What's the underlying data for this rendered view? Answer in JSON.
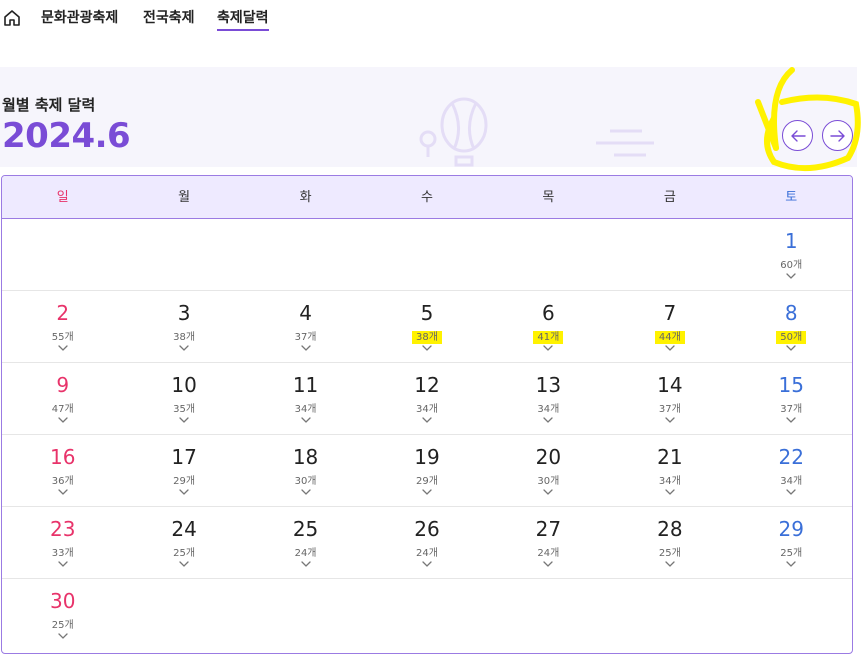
{
  "nav": {
    "items": [
      {
        "label": "문화관광축제"
      },
      {
        "label": "전국축제"
      },
      {
        "label": "축제달력",
        "active": true
      }
    ]
  },
  "header": {
    "subtitle": "월별 축제 달력",
    "month": "2024.6"
  },
  "colors": {
    "accent": "#7a4cd6",
    "sunday": "#e8336a",
    "saturday": "#3a6fd8",
    "highlight": "#fff200"
  },
  "weekdays": [
    "일",
    "월",
    "화",
    "수",
    "목",
    "금",
    "토"
  ],
  "weeks": [
    [
      null,
      null,
      null,
      null,
      null,
      null,
      {
        "day": "1",
        "count": "60개"
      }
    ],
    [
      {
        "day": "2",
        "count": "55개"
      },
      {
        "day": "3",
        "count": "38개"
      },
      {
        "day": "4",
        "count": "37개"
      },
      {
        "day": "5",
        "count": "38개",
        "highlighted": true
      },
      {
        "day": "6",
        "count": "41개",
        "highlighted": true
      },
      {
        "day": "7",
        "count": "44개",
        "highlighted": true
      },
      {
        "day": "8",
        "count": "50개",
        "highlighted": true
      }
    ],
    [
      {
        "day": "9",
        "count": "47개"
      },
      {
        "day": "10",
        "count": "35개"
      },
      {
        "day": "11",
        "count": "34개"
      },
      {
        "day": "12",
        "count": "34개"
      },
      {
        "day": "13",
        "count": "34개"
      },
      {
        "day": "14",
        "count": "37개"
      },
      {
        "day": "15",
        "count": "37개"
      }
    ],
    [
      {
        "day": "16",
        "count": "36개"
      },
      {
        "day": "17",
        "count": "29개"
      },
      {
        "day": "18",
        "count": "30개"
      },
      {
        "day": "19",
        "count": "29개"
      },
      {
        "day": "20",
        "count": "30개"
      },
      {
        "day": "21",
        "count": "34개"
      },
      {
        "day": "22",
        "count": "34개"
      }
    ],
    [
      {
        "day": "23",
        "count": "33개"
      },
      {
        "day": "24",
        "count": "25개"
      },
      {
        "day": "25",
        "count": "24개"
      },
      {
        "day": "26",
        "count": "24개"
      },
      {
        "day": "27",
        "count": "24개"
      },
      {
        "day": "28",
        "count": "25개"
      },
      {
        "day": "29",
        "count": "25개"
      }
    ],
    [
      {
        "day": "30",
        "count": "25개"
      },
      null,
      null,
      null,
      null,
      null,
      null
    ]
  ]
}
